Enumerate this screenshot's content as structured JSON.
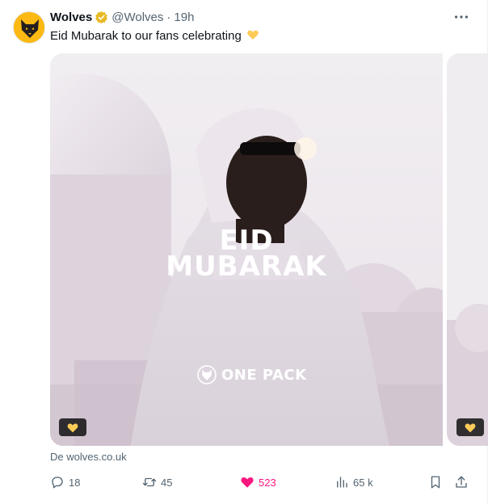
{
  "tweet": {
    "author_name": "Wolves",
    "handle": "@Wolves",
    "separator": "·",
    "time": "19h",
    "text": "Eid Mubarak to our fans celebrating",
    "media": {
      "headline_line1": "EID",
      "headline_line2": "MUBARAK",
      "brand_text": "ONE PACK"
    },
    "link_text": "De wolves.co.uk",
    "actions": {
      "replies": "18",
      "retweets": "45",
      "likes": "523",
      "views": "65 k"
    }
  },
  "colors": {
    "accent_like": "#f91880",
    "muted_text": "#536471",
    "verified_gold": "#e8b923",
    "brand_gold": "#fdb913"
  },
  "icons": [
    "wolves-logo-icon",
    "verified-badge-icon",
    "more-icon",
    "heart-emoji-icon",
    "reply-icon",
    "retweet-icon",
    "like-icon",
    "views-icon",
    "bookmark-icon",
    "share-icon"
  ]
}
